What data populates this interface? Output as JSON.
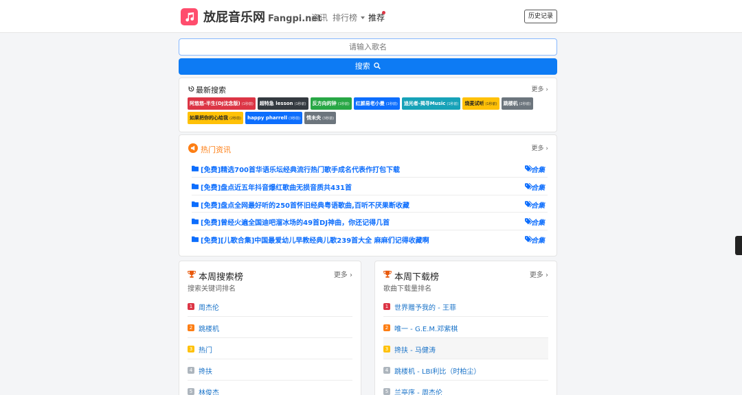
{
  "header": {
    "brand": "放屁音乐网",
    "brand_sub": "Fangpi.net",
    "nav": [
      {
        "label": "资讯"
      },
      {
        "label": "排行榜"
      },
      {
        "label": "推荐"
      }
    ],
    "history_button": "历史记录"
  },
  "search": {
    "placeholder": "请输入歌名",
    "button_label": "搜索"
  },
  "recent_search": {
    "title": "最新搜索",
    "more": "更多 ›",
    "tags": [
      {
        "text": "阿悠悠-半生(DJ沈念版)",
        "count": "(1秒前)",
        "color": "#dc3545"
      },
      {
        "text": "超特急 lesson",
        "count": "(1秒前)",
        "color": "#343a40"
      },
      {
        "text": "反方向的钟",
        "count": "(1秒前)",
        "color": "#28a745"
      },
      {
        "text": "红颜易老小曼",
        "count": "(1秒前)",
        "color": "#0d6efd"
      },
      {
        "text": "追光者-揭寻Music",
        "count": "(1秒前)",
        "color": "#17a2b8"
      },
      {
        "text": "烧麦试听",
        "count": "(1秒前)",
        "color": "#ffc107"
      },
      {
        "text": "跳楼机",
        "count": "(2秒前)",
        "color": "#6c757d"
      },
      {
        "text": "如果把你的心给我",
        "count": "(2秒前)",
        "color": "#ffc107"
      },
      {
        "text": "happy pharrell",
        "count": "(3秒前)",
        "color": "#0d6efd"
      },
      {
        "text": "情未央",
        "count": "(3秒前)",
        "color": "#6c757d"
      }
    ]
  },
  "hot_news": {
    "title": "热门资讯",
    "more": "更多 ›",
    "items": [
      {
        "title": "[免费]精选700首华语乐坛经典流行热门歌手成名代表作打包下载",
        "tag": "合集"
      },
      {
        "title": "[免费]盘点近五年抖音爆红歌曲无损音质共431首",
        "tag": "合集"
      },
      {
        "title": "[免费]盘点全网最好听的250首怀旧经典粤语歌曲,百听不厌果断收藏",
        "tag": "合集"
      },
      {
        "title": "[免费]曾经火遍全国迪吧溜冰场的49首DJ神曲，你还记得几首",
        "tag": "合集"
      },
      {
        "title": "[免费][儿歌合集]中国最爱幼儿早教经典儿歌239首大全 麻麻们记得收藏啊",
        "tag": "合集"
      }
    ]
  },
  "weekly_search": {
    "title": "本周搜索榜",
    "subtitle": "搜索关键词排名",
    "more": "更多 ›",
    "items": [
      {
        "rank": "1",
        "name": "周杰伦",
        "color": "#dc3545"
      },
      {
        "rank": "2",
        "name": "跳楼机",
        "color": "#fd7e14"
      },
      {
        "rank": "3",
        "name": "热门",
        "color": "#ffc107"
      },
      {
        "rank": "4",
        "name": "搀扶",
        "color": "#adb5bd"
      },
      {
        "rank": "5",
        "name": "林俊杰",
        "color": "#adb5bd"
      }
    ]
  },
  "weekly_download": {
    "title": "本周下载榜",
    "subtitle": "歌曲下载量排名",
    "more": "更多 ›",
    "items": [
      {
        "rank": "1",
        "name": "世界赠予我的 - 王菲",
        "color": "#dc3545"
      },
      {
        "rank": "2",
        "name": "唯一 - G.E.M.邓紫棋",
        "color": "#fd7e14"
      },
      {
        "rank": "3",
        "name": "搀扶 - 马健涛",
        "color": "#ffc107"
      },
      {
        "rank": "4",
        "name": "跳楼机 - LBI利比（时柏尘）",
        "color": "#adb5bd"
      },
      {
        "rank": "5",
        "name": "兰亭序 - 周杰伦",
        "color": "#adb5bd"
      }
    ]
  }
}
